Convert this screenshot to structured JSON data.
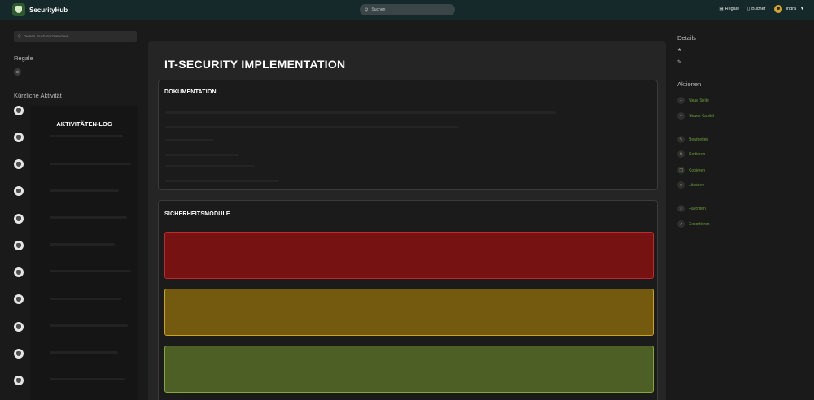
{
  "app": {
    "name": "SecurityHub"
  },
  "header": {
    "search_placeholder": "Suchen",
    "shelves_label": "Regale",
    "books_label": "Bücher",
    "user_name": "Indra"
  },
  "sidebar_left": {
    "search_placeholder": "Dieses Buch durchsuchen",
    "shelves_heading": "Regale",
    "recent_heading": "Kürzliche Aktivität",
    "activity_log_title": "AKTIVITÄTEN-LOG",
    "activity_count": 10
  },
  "page": {
    "title": "IT-SECURITY IMPLEMENTATION",
    "sections": [
      {
        "heading": "DOKUMENTATION"
      },
      {
        "heading": "SICHERHEITSMODULE"
      }
    ],
    "modules": [
      {
        "status": "critical",
        "color": "#761212",
        "border": "#c02a2a"
      },
      {
        "status": "warning",
        "color": "#735a0e",
        "border": "#c9a21f"
      },
      {
        "status": "ok",
        "color": "#4d5f24",
        "border": "#82a93a"
      }
    ]
  },
  "sidebar_right": {
    "details_heading": "Details",
    "actions_heading": "Aktionen",
    "actions": [
      {
        "label": "Neue Seite",
        "icon": "plus-icon"
      },
      {
        "label": "Neues Kapitel",
        "icon": "plus-icon"
      },
      {
        "label": "Bearbeiten",
        "icon": "pencil-icon"
      },
      {
        "label": "Sortieren",
        "icon": "sort-icon"
      },
      {
        "label": "Kopieren",
        "icon": "copy-icon"
      },
      {
        "label": "Löschen",
        "icon": "trash-icon"
      },
      {
        "label": "Favoriten",
        "icon": "star-icon"
      },
      {
        "label": "Exportieren",
        "icon": "export-icon"
      }
    ]
  },
  "colors": {
    "accent": "#6fa13a",
    "header_bg": "#15292b"
  }
}
